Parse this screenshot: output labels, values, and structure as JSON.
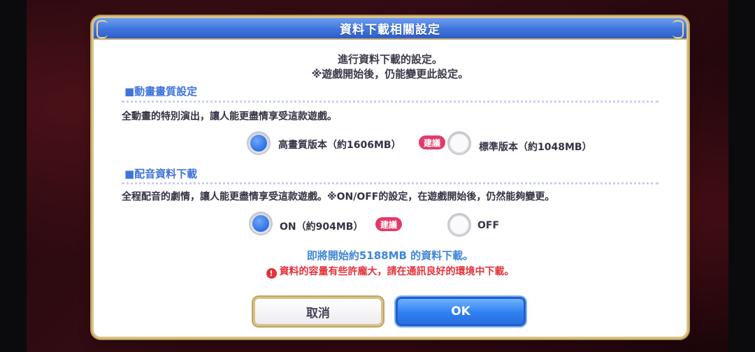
{
  "dialog": {
    "title": "資料下載相關設定",
    "intro_line1": "進行資料下載的設定。",
    "intro_line2": "※遊戲開始後，仍能變更此設定。"
  },
  "animation_quality": {
    "heading": "■動畫畫質設定",
    "description": "全動畫的特別演出，讓人能更盡情享受這款遊戲。",
    "options": [
      {
        "label": "高畫質版本（約1606MB）",
        "selected": true,
        "badge": "建議"
      },
      {
        "label": "標準版本（約1048MB）",
        "selected": false
      }
    ]
  },
  "voice_download": {
    "heading": "■配音資料下載",
    "description": "全程配音的劇情，讓人能更盡情享受這款遊戲。※ON/OFF的設定，在遊戲開始後，仍然能夠變更。",
    "options": [
      {
        "label": "ON（約904MB）",
        "selected": true,
        "badge": "建議"
      },
      {
        "label": "OFF",
        "selected": false
      }
    ]
  },
  "summary": {
    "total_text": "即將開始約5188MB 的資料下載。",
    "warning_text": "資料的容量有些許龐大，請在通訊良好的環境中下載。",
    "warning_icon": "!"
  },
  "buttons": {
    "cancel": "取消",
    "ok": "OK"
  },
  "colors": {
    "accent": "#3f74dc",
    "badge": "#e33a6a",
    "warning": "#e3323a"
  }
}
